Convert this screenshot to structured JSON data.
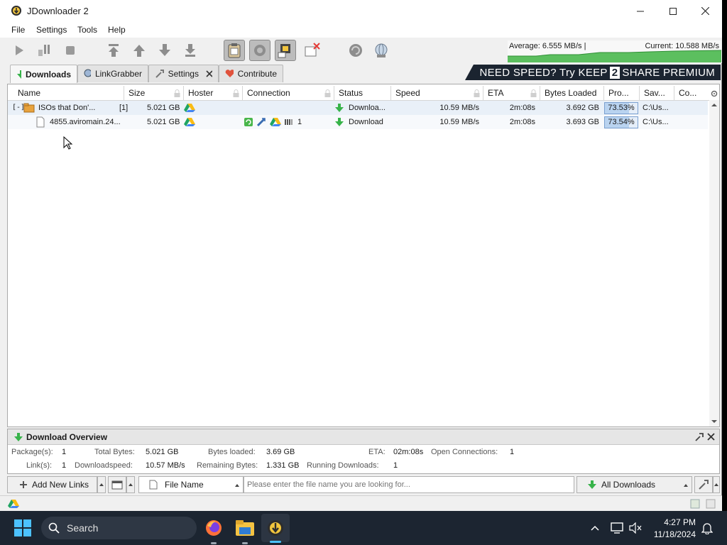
{
  "window": {
    "title": "JDownloader 2"
  },
  "menu": [
    "File",
    "Settings",
    "Tools",
    "Help"
  ],
  "toolbar": {
    "icons": [
      "start-downloads",
      "pause-downloads",
      "stop-downloads",
      "move-to-top",
      "move-up",
      "move-down",
      "move-to-bottom",
      "clipboard-observer",
      "auto-reconnect",
      "premium",
      "silent-mode",
      "reconnect",
      "update"
    ],
    "speed": {
      "average": "Average: 6.555 MB/s |",
      "current": "Current: 10.588 MB/s"
    }
  },
  "tabs": [
    {
      "label": "Downloads",
      "icon": "download-arrow-icon",
      "active": true
    },
    {
      "label": "LinkGrabber",
      "icon": "linkgrabber-icon",
      "active": false
    },
    {
      "label": "Settings",
      "icon": "wrench-icon",
      "active": false,
      "closable": true
    },
    {
      "label": "Contribute",
      "icon": "heart-icon",
      "active": false
    }
  ],
  "banner": {
    "pre": "NEED SPEED? Try ",
    "keep": "KEEP",
    "two": "2",
    "share": "SHARE",
    "premium": " PREMIUM"
  },
  "table": {
    "columns": [
      "Name",
      "Size",
      "Hoster",
      "Connection",
      "Status",
      "Speed",
      "ETA",
      "Bytes Loaded",
      "Pro...",
      "Sav...",
      "Co..."
    ],
    "rows": [
      {
        "type": "package",
        "expander": "[-]",
        "name": "ISOs that Don'...",
        "count": "[1]",
        "size": "5.021 GB",
        "hoster_icon": "google-drive-icon",
        "status": "Downloa...",
        "speed": "10.59 MB/s",
        "eta": "2m:08s",
        "bytes_loaded": "3.692 GB",
        "progress_label": "73.53%",
        "progress": 0.7353,
        "save_to": "C:\\Us..."
      },
      {
        "type": "link",
        "name": "4855.aviromain.24...",
        "size": "5.021 GB",
        "hoster_icon": "google-drive-icon",
        "connections": "1",
        "status": "Download",
        "speed": "10.59 MB/s",
        "eta": "2m:08s",
        "bytes_loaded": "3.693 GB",
        "progress_label": "73.54%",
        "progress": 0.7354,
        "save_to": "C:\\Us..."
      }
    ]
  },
  "overview": {
    "title": "Download Overview",
    "packages_label": "Package(s):",
    "packages": "1",
    "total_bytes_label": "Total Bytes:",
    "total_bytes": "5.021 GB",
    "bytes_loaded_label": "Bytes loaded:",
    "bytes_loaded": "3.69 GB",
    "eta_label": "ETA:",
    "eta": "02m:08s",
    "open_connections_label": "Open Connections:",
    "open_connections": "1",
    "links_label": "Link(s):",
    "links": "1",
    "downloadspeed_label": "Downloadspeed:",
    "downloadspeed": "10.57 MB/s",
    "remaining_bytes_label": "Remaining Bytes:",
    "remaining_bytes": "1.331 GB",
    "running_downloads_label": "Running Downloads:",
    "running_downloads": "1"
  },
  "bottom": {
    "add_links": "Add New Links",
    "search_field": "File Name",
    "search_placeholder": "Please enter the file name you are looking for...",
    "view_filter": "All Downloads"
  },
  "taskbar": {
    "search": "Search",
    "time": "4:27 PM",
    "date": "11/18/2024"
  },
  "colors": {
    "accent_green": "#37b34a",
    "selection": "#e9f0f8",
    "banner": "#1b2430",
    "taskbar": "#1c2531"
  }
}
